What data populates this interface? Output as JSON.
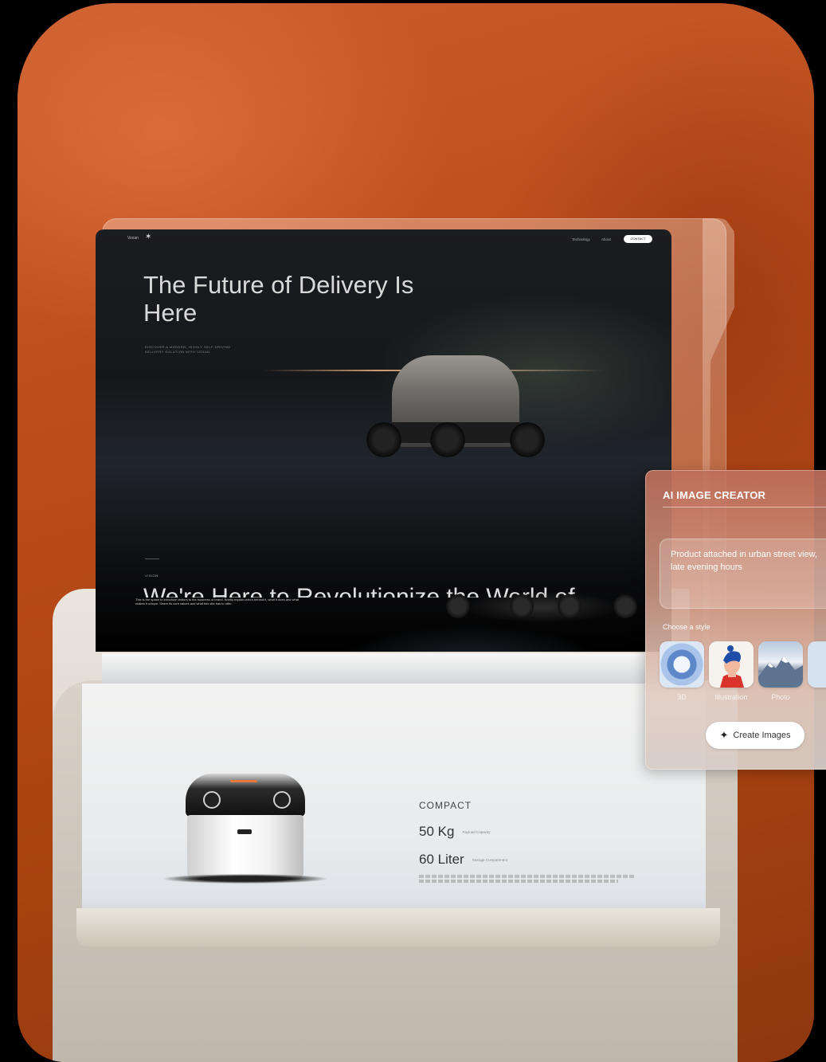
{
  "site": {
    "logo_text": "Voxan",
    "nav": [
      "Technology",
      "About"
    ],
    "contact_label": "CONTACT",
    "hero_title": "The Future of Delivery Is Here",
    "hero_subtitle": "DISCOVER A MODERN, HIGHLY SELF DRIVING DELIVERY SOLUTION WITH VOXAN",
    "vision_label": "VISION",
    "vision_heading": "We're Here to Revolutionize the World of",
    "vision_body": "This is the space to introduce visitors to the business or brand. Briefly explain who's behind it, what it does and what makes it unique. Share its core values and what this site has to offer."
  },
  "specs": {
    "title": "COMPACT",
    "payload_value": "50 Kg",
    "payload_label": "Payload Capacity",
    "storage_value": "60 Liter",
    "storage_label": "Storage Compartment"
  },
  "ai_panel": {
    "title": "AI IMAGE CREATOR",
    "prompt": "Product attached in urban street view, late evening hours",
    "style_label": "Choose a style",
    "styles": [
      "3D",
      "Illustration",
      "Photo"
    ],
    "create_label": "Create Images",
    "sparkle_icon": "sparkle-icon"
  },
  "colors": {
    "background_orange": "#bb4d1c",
    "accent_led": "#e67a3c"
  }
}
